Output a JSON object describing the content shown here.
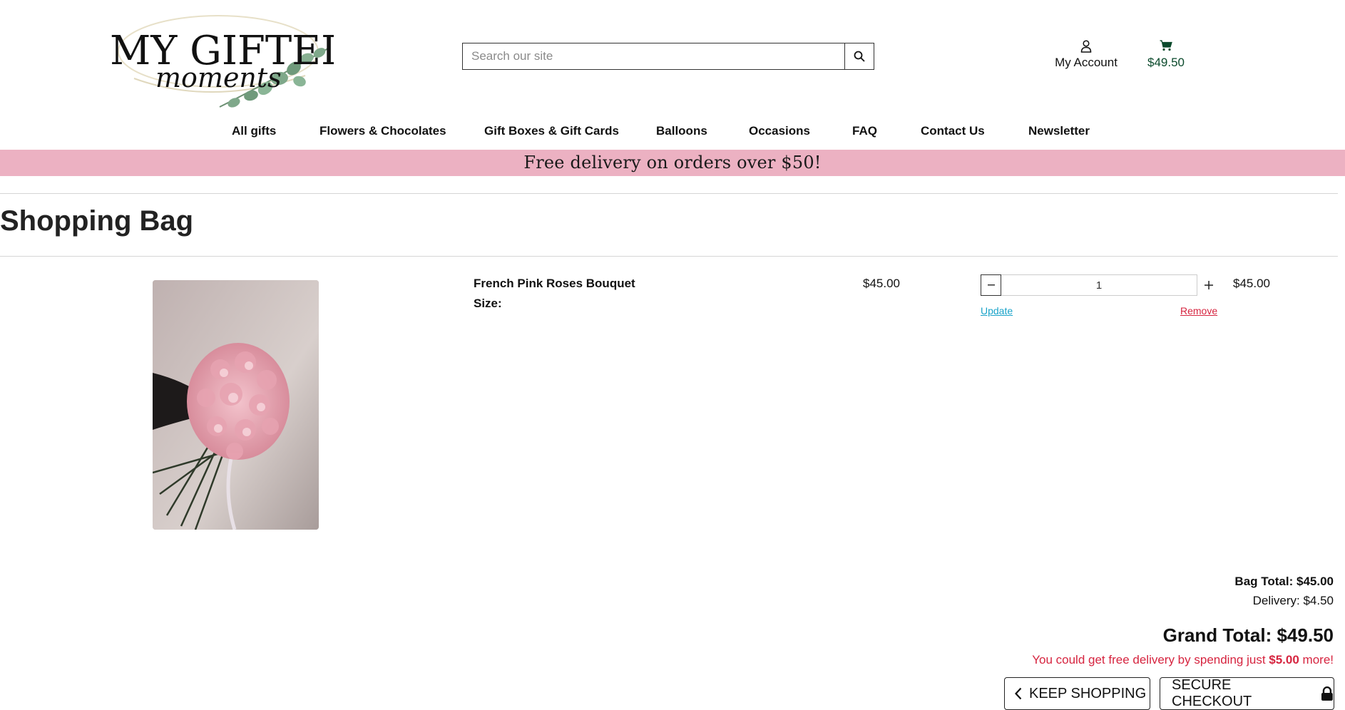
{
  "brand": {
    "logo_line1": "MY GIFTED",
    "logo_line2": "moments"
  },
  "search": {
    "placeholder": "Search our site",
    "icon": "search-icon"
  },
  "account": {
    "label": "My Account",
    "icon": "user-icon"
  },
  "cart": {
    "total": "$49.50",
    "icon": "cart-icon",
    "color": "#0b4a2c"
  },
  "nav": {
    "items": [
      "All gifts",
      "Flowers & Chocolates",
      "Gift Boxes & Gift Cards",
      "Balloons",
      "Occasions",
      "FAQ",
      "Contact Us",
      "Newsletter"
    ]
  },
  "banner": {
    "text": "Free delivery on orders over $50!",
    "color": "#ecb1c2"
  },
  "page": {
    "title": "Shopping Bag"
  },
  "bag": {
    "items": [
      {
        "name": "French Pink Roses Bouquet",
        "size_label": "Size:",
        "unit_price": "$45.00",
        "quantity": "1",
        "line_total": "$45.00",
        "update_label": "Update",
        "remove_label": "Remove"
      }
    ]
  },
  "totals": {
    "bag_total": "Bag Total: $45.00",
    "delivery": "Delivery: $4.50",
    "grand_total": "Grand Total: $49.50",
    "free_msg_prefix": "You could get free delivery by spending just ",
    "free_msg_amount": "$5.00",
    "free_msg_suffix": " more!"
  },
  "actions": {
    "keep_shopping": "KEEP SHOPPING",
    "secure_checkout": "SECURE CHECKOUT"
  }
}
